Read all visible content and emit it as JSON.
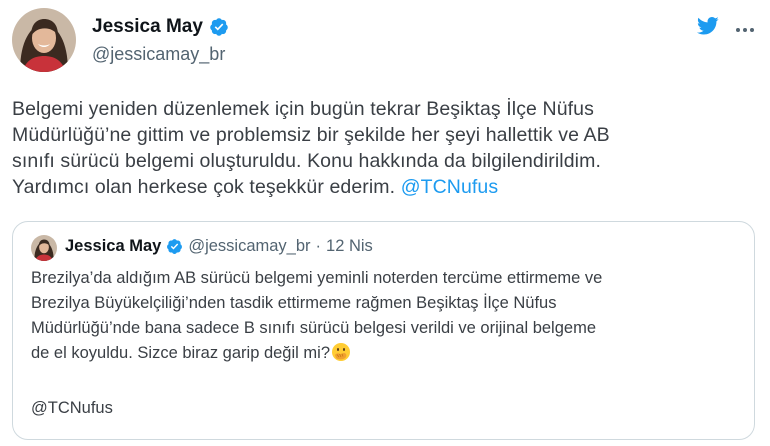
{
  "colors": {
    "accent": "#1d9bf0",
    "text_primary": "#0f1419",
    "text_secondary": "#536471",
    "border": "#cfd9de"
  },
  "author": {
    "name": "Jessica May",
    "handle": "@jessicamay_br",
    "verified_icon": "verified-badge-icon"
  },
  "header_icons": {
    "brand": "twitter-bird-icon",
    "menu": "more-options-icon"
  },
  "tweet": {
    "lines": [
      "Belgemi yeniden düzenlemek için bugün tekrar Beşiktaş İlçe Nüfus",
      "Müdürlüğü’ne gittim ve problemsiz bir şekilde her şeyi hallettik ve AB",
      "sınıfı sürücü belgemi oluşturuldu. Konu hakkında da bilgilendirildim.",
      "Yardımcı olan herkese çok teşekkür ederim."
    ],
    "mention": "@TCNufus"
  },
  "quoted_tweet": {
    "name": "Jessica May",
    "handle": "@jessicamay_br",
    "separator": "·",
    "date": "12 Nis",
    "lines": [
      "Brezilya’da aldığım AB sürücü belgemi yeminli noterden tercüme ettirmeme ve",
      "Brezilya Büyükelçiliği’nden tasdik ettirmeme rağmen Beşiktaş İlçe Nüfus",
      "Müdürlüğü’nde bana sadece B sınıfı sürücü belgesi verildi ve orijinal belgeme",
      "de el koyuldu. Sizce biraz garip değil mi?"
    ],
    "emoji": "face-with-hand-over-mouth-icon",
    "mention": "@TCNufus"
  }
}
